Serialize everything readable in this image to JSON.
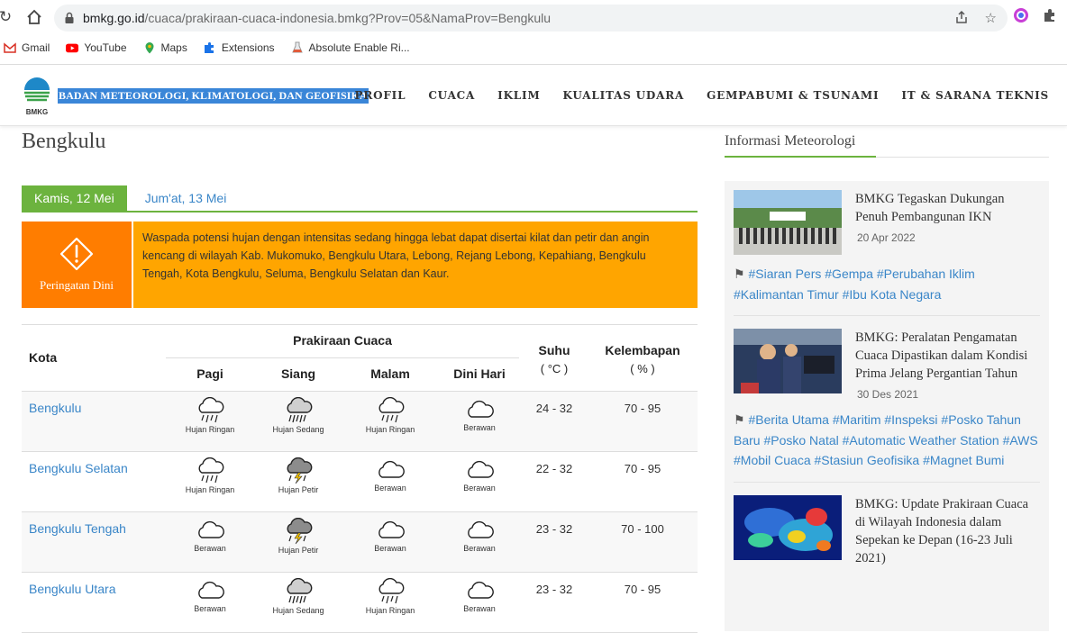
{
  "browser": {
    "url_host": "bmkg.go.id",
    "url_path": "/cuaca/prakiraan-cuaca-indonesia.bmkg?Prov=05&NamaProv=Bengkulu",
    "bookmarks": [
      "Gmail",
      "YouTube",
      "Maps",
      "Extensions",
      "Absolute Enable Ri..."
    ]
  },
  "site": {
    "logo_text": "BMKG",
    "brand": "BADAN METEOROLOGI, KLIMATOLOGI, DAN GEOFISIKA",
    "nav": [
      "PROFIL",
      "CUACA",
      "IKLIM",
      "KUALITAS UDARA",
      "GEMPABUMI & TSUNAMI",
      "IT & SARANA TEKNIS"
    ]
  },
  "page": {
    "title": "Bengkulu",
    "tabs": [
      "Kamis, 12 Mei",
      "Jum'at, 13 Mei"
    ],
    "warning_label": "Peringatan Dini",
    "warning_text": "Waspada potensi hujan dengan intensitas sedang hingga lebat dapat disertai kilat dan petir dan angin kencang di wilayah Kab. Mukomuko, Bengkulu Utara, Lebong, Rejang Lebong, Kepahiang, Bengkulu Tengah, Kota Bengkulu, Seluma, Bengkulu Selatan dan Kaur."
  },
  "table": {
    "col_kota": "Kota",
    "col_prakiraan": "Prakiraan Cuaca",
    "periods": [
      "Pagi",
      "Siang",
      "Malam",
      "Dini Hari"
    ],
    "col_suhu": "Suhu",
    "col_suhu_unit": "( °C )",
    "col_kelembapan": "Kelembapan",
    "col_kelembapan_unit": "( % )",
    "rows": [
      {
        "city": "Bengkulu",
        "weather": [
          "Hujan Ringan",
          "Hujan Sedang",
          "Hujan Ringan",
          "Berawan"
        ],
        "suhu": "24 - 32",
        "kelembapan": "70 - 95"
      },
      {
        "city": "Bengkulu Selatan",
        "weather": [
          "Hujan Ringan",
          "Hujan Petir",
          "Berawan",
          "Berawan"
        ],
        "suhu": "22 - 32",
        "kelembapan": "70 - 95"
      },
      {
        "city": "Bengkulu Tengah",
        "weather": [
          "Berawan",
          "Hujan Petir",
          "Berawan",
          "Berawan"
        ],
        "suhu": "23 - 32",
        "kelembapan": "70 - 100"
      },
      {
        "city": "Bengkulu Utara",
        "weather": [
          "Berawan",
          "Hujan Sedang",
          "Hujan Ringan",
          "Berawan"
        ],
        "suhu": "23 - 32",
        "kelembapan": "70 - 95"
      }
    ]
  },
  "sidebar": {
    "title": "Informasi Meteorologi",
    "news": [
      {
        "title": "BMKG Tegaskan Dukungan Penuh Pembangunan IKN",
        "date": "20 Apr 2022",
        "tags": "#Siaran Pers #Gempa #Perubahan Iklim #Kalimantan Timur #Ibu Kota Negara"
      },
      {
        "title": "BMKG: Peralatan Pengamatan Cuaca Dipastikan dalam Kondisi Prima Jelang Pergantian Tahun",
        "date": "30 Des 2021",
        "tags": "#Berita Utama #Maritim #Inspeksi #Posko Tahun Baru #Posko Natal #Automatic Weather Station #AWS #Mobil Cuaca #Stasiun Geofisika #Magnet Bumi"
      },
      {
        "title": "BMKG: Update Prakiraan Cuaca di Wilayah Indonesia dalam Sepekan ke Depan (16-23 Juli 2021)",
        "date": "",
        "tags": ""
      }
    ]
  }
}
